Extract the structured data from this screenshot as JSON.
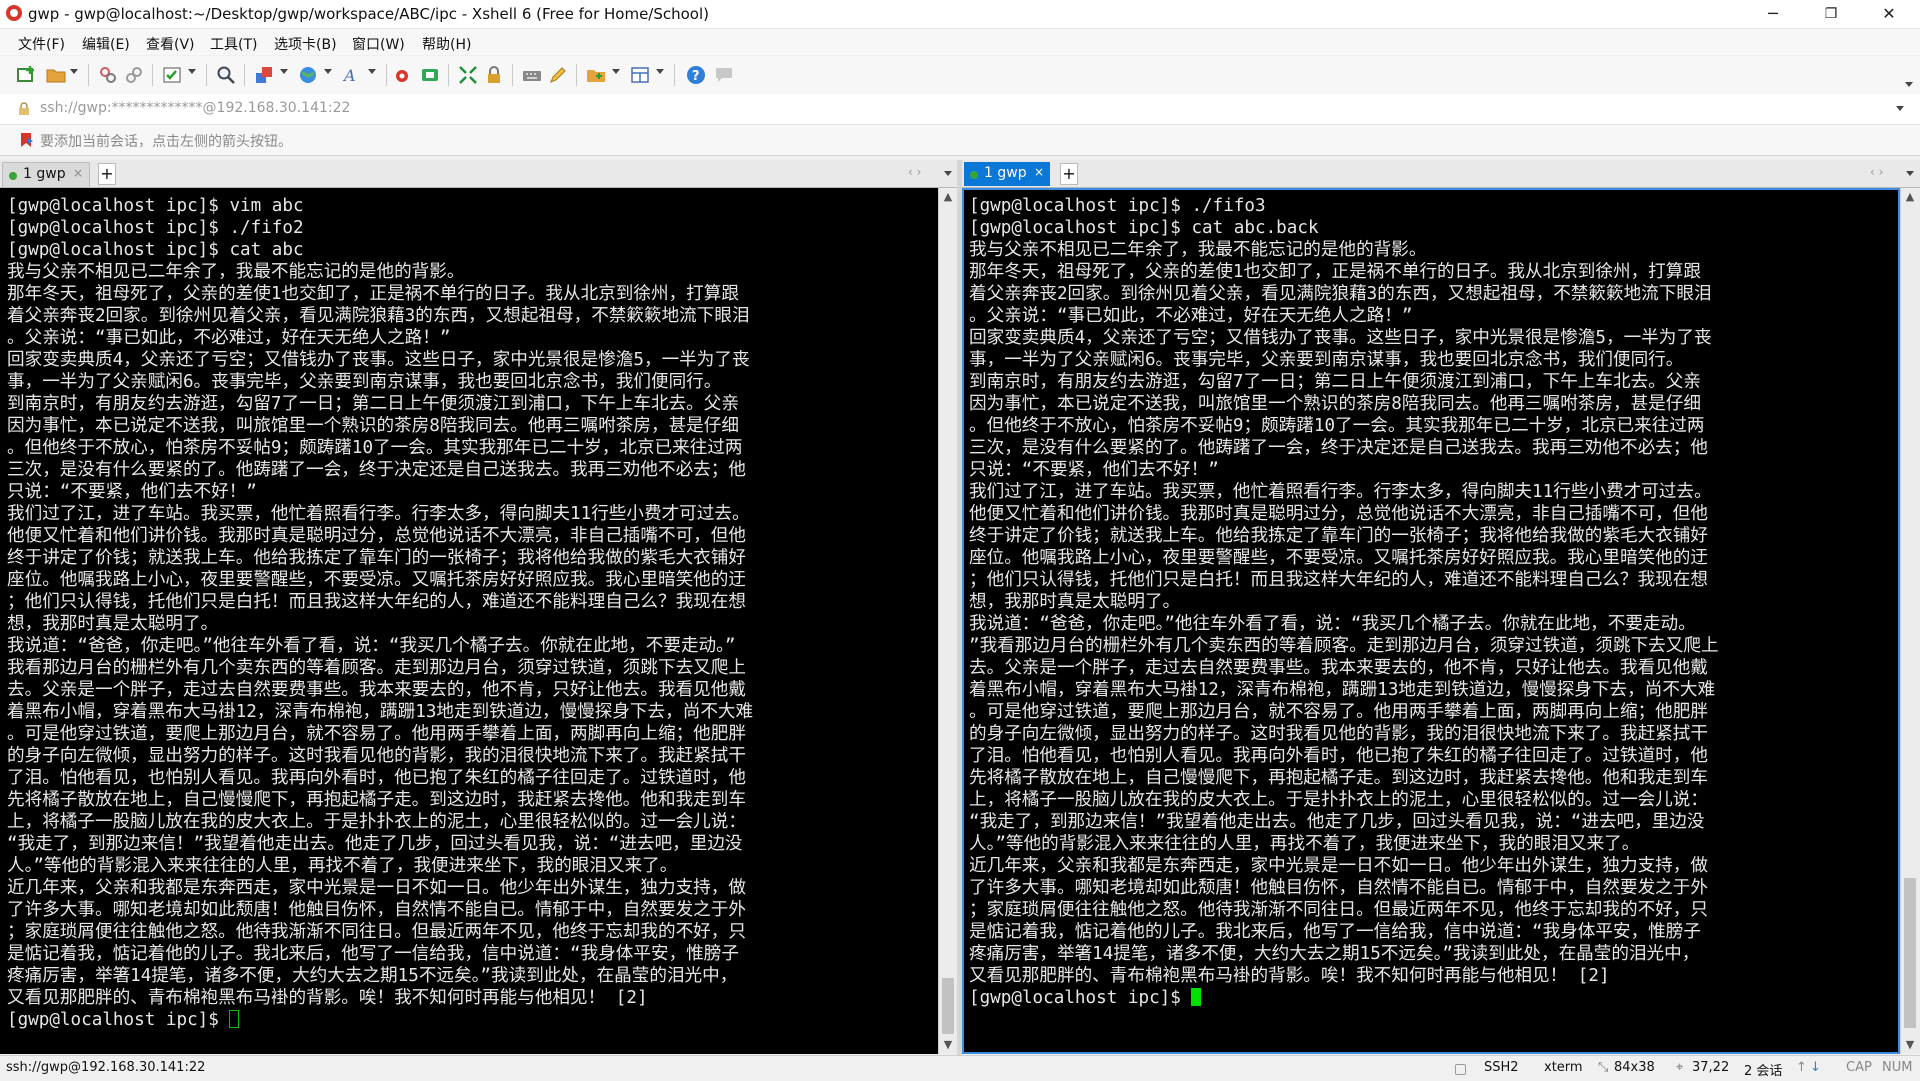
{
  "window": {
    "title": "gwp - gwp@localhost:~/Desktop/gwp/workspace/ABC/ipc - Xshell 6 (Free for Home/School)",
    "controls": {
      "minimize": "─",
      "restore": "❐",
      "close": "✕"
    }
  },
  "menu": [
    "文件(F)",
    "编辑(E)",
    "查看(V)",
    "工具(T)",
    "选项卡(B)",
    "窗口(W)",
    "帮助(H)"
  ],
  "address": {
    "value": "ssh://gwp:*************@192.168.30.141:22"
  },
  "info": {
    "text": "要添加当前会话，点击左侧的箭头按钮。"
  },
  "tabs": {
    "left": {
      "label": "1 gwp",
      "close": "×",
      "add": "+"
    },
    "right": {
      "label": "1 gwp",
      "close": "×",
      "add": "+"
    }
  },
  "terminal_left": {
    "text": "[gwp@localhost ipc]$ vim abc\n[gwp@localhost ipc]$ ./fifo2\n[gwp@localhost ipc]$ cat abc\n我与父亲不相见已二年余了，我最不能忘记的是他的背影。\n那年冬天，祖母死了，父亲的差使1也交卸了，正是祸不单行的日子。我从北京到徐州，打算跟\n着父亲奔丧2回家。到徐州见着父亲，看见满院狼藉3的东西，又想起祖母，不禁簌簌地流下眼泪\n。父亲说：“事已如此，不必难过，好在天无绝人之路！”\n回家变卖典质4，父亲还了亏空；又借钱办了丧事。这些日子，家中光景很是惨澹5，一半为了丧\n事，一半为了父亲赋闲6。丧事完毕，父亲要到南京谋事，我也要回北京念书，我们便同行。\n到南京时，有朋友约去游逛，勾留7了一日；第二日上午便须渡江到浦口，下午上车北去。父亲\n因为事忙，本已说定不送我，叫旅馆里一个熟识的茶房8陪我同去。他再三嘱咐茶房，甚是仔细\n。但他终于不放心，怕茶房不妥帖9；颇踌躇10了一会。其实我那年已二十岁，北京已来往过两\n三次，是没有什么要紧的了。他踌躇了一会，终于决定还是自己送我去。我再三劝他不必去；他\n只说：“不要紧，他们去不好！”\n我们过了江，进了车站。我买票，他忙着照看行李。行李太多，得向脚夫11行些小费才可过去。\n他便又忙着和他们讲价钱。我那时真是聪明过分，总觉他说话不大漂亮，非自己插嘴不可，但他\n终于讲定了价钱；就送我上车。他给我拣定了靠车门的一张椅子；我将他给我做的紫毛大衣铺好\n座位。他嘱我路上小心，夜里要警醒些，不要受凉。又嘱托茶房好好照应我。我心里暗笑他的迂\n；他们只认得钱，托他们只是白托！而且我这样大年纪的人，难道还不能料理自己么？我现在想\n想，我那时真是太聪明了。\n我说道：“爸爸，你走吧。”他往车外看了看，说：“我买几个橘子去。你就在此地，不要走动。”\n我看那边月台的栅栏外有几个卖东西的等着顾客。走到那边月台，须穿过铁道，须跳下去又爬上\n去。父亲是一个胖子，走过去自然要费事些。我本来要去的，他不肯，只好让他去。我看见他戴\n着黑布小帽，穿着黑布大马褂12，深青布棉袍，蹒跚13地走到铁道边，慢慢探身下去，尚不大难\n。可是他穿过铁道，要爬上那边月台，就不容易了。他用两手攀着上面，两脚再向上缩；他肥胖\n的身子向左微倾，显出努力的样子。这时我看见他的背影，我的泪很快地流下来了。我赶紧拭干\n了泪。怕他看见，也怕别人看见。我再向外看时，他已抱了朱红的橘子往回走了。过铁道时，他\n先将橘子散放在地上，自己慢慢爬下，再抱起橘子走。到这边时，我赶紧去搀他。他和我走到车\n上，将橘子一股脑儿放在我的皮大衣上。于是扑扑衣上的泥土，心里很轻松似的。过一会儿说：\n“我走了，到那边来信！”我望着他走出去。他走了几步，回过头看见我，说：“进去吧，里边没\n人。”等他的背影混入来来往往的人里，再找不着了，我便进来坐下，我的眼泪又来了。\n近几年来，父亲和我都是东奔西走，家中光景是一日不如一日。他少年出外谋生，独力支持，做\n了许多大事。哪知老境却如此颓唐！他触目伤怀，自然情不能自已。情郁于中，自然要发之于外\n；家庭琐屑便往往触他之怒。他待我渐渐不同往日。但最近两年不见，他终于忘却我的不好，只\n是惦记着我，惦记着他的儿子。我北来后，他写了一信给我，信中说道：“我身体平安，惟膀子\n疼痛厉害，举箸14提笔，诸多不便，大约大去之期15不远矣。”我读到此处，在晶莹的泪光中，\n又看见那肥胖的、青布棉袍黑布马褂的背影。唉！我不知何时再能与他相见！ [2]\n[gwp@localhost ipc]$ "
  },
  "terminal_right": {
    "text": "[gwp@localhost ipc]$ ./fifo3\n[gwp@localhost ipc]$ cat abc.back\n我与父亲不相见已二年余了，我最不能忘记的是他的背影。\n那年冬天，祖母死了，父亲的差使1也交卸了，正是祸不单行的日子。我从北京到徐州，打算跟\n着父亲奔丧2回家。到徐州见着父亲，看见满院狼藉3的东西，又想起祖母，不禁簌簌地流下眼泪\n。父亲说：“事已如此，不必难过，好在天无绝人之路！”\n回家变卖典质4，父亲还了亏空；又借钱办了丧事。这些日子，家中光景很是惨澹5，一半为了丧\n事，一半为了父亲赋闲6。丧事完毕，父亲要到南京谋事，我也要回北京念书，我们便同行。\n到南京时，有朋友约去游逛，勾留7了一日；第二日上午便须渡江到浦口，下午上车北去。父亲\n因为事忙，本已说定不送我，叫旅馆里一个熟识的茶房8陪我同去。他再三嘱咐茶房，甚是仔细\n。但他终于不放心，怕茶房不妥帖9；颇踌躇10了一会。其实我那年已二十岁，北京已来往过两\n三次，是没有什么要紧的了。他踌躇了一会，终于决定还是自己送我去。我再三劝他不必去；他\n只说：“不要紧，他们去不好！”\n我们过了江，进了车站。我买票，他忙着照看行李。行李太多，得向脚夫11行些小费才可过去。\n他便又忙着和他们讲价钱。我那时真是聪明过分，总觉他说话不大漂亮，非自己插嘴不可，但他\n终于讲定了价钱；就送我上车。他给我拣定了靠车门的一张椅子；我将他给我做的紫毛大衣铺好\n座位。他嘱我路上小心，夜里要警醒些，不要受凉。又嘱托茶房好好照应我。我心里暗笑他的迂\n；他们只认得钱，托他们只是白托！而且我这样大年纪的人，难道还不能料理自己么？我现在想\n想，我那时真是太聪明了。\n我说道：“爸爸，你走吧。”他往车外看了看，说：“我买几个橘子去。你就在此地，不要走动。\n”我看那边月台的栅栏外有几个卖东西的等着顾客。走到那边月台，须穿过铁道，须跳下去又爬上\n去。父亲是一个胖子，走过去自然要费事些。我本来要去的，他不肯，只好让他去。我看见他戴\n着黑布小帽，穿着黑布大马褂12，深青布棉袍，蹒跚13地走到铁道边，慢慢探身下去，尚不大难\n。可是他穿过铁道，要爬上那边月台，就不容易了。他用两手攀着上面，两脚再向上缩；他肥胖\n的身子向左微倾，显出努力的样子。这时我看见他的背影，我的泪很快地流下来了。我赶紧拭干\n了泪。怕他看见，也怕别人看见。我再向外看时，他已抱了朱红的橘子往回走了。过铁道时，他\n先将橘子散放在地上，自己慢慢爬下，再抱起橘子走。到这边时，我赶紧去搀他。他和我走到车\n上，将橘子一股脑儿放在我的皮大衣上。于是扑扑衣上的泥土，心里很轻松似的。过一会儿说：\n“我走了，到那边来信！”我望着他走出去。他走了几步，回过头看见我，说：“进去吧，里边没\n人。”等他的背影混入来来往往的人里，再找不着了，我便进来坐下，我的眼泪又来了。\n近几年来，父亲和我都是东奔西走，家中光景是一日不如一日。他少年出外谋生，独力支持，做\n了许多大事。哪知老境却如此颓唐！他触目伤怀，自然情不能自已。情郁于中，自然要发之于外\n；家庭琐屑便往往触他之怒。他待我渐渐不同往日。但最近两年不见，他终于忘却我的不好，只\n是惦记着我，惦记着他的儿子。我北来后，他写了一信给我，信中说道：“我身体平安，惟膀子\n疼痛厉害，举箸14提笔，诸多不便，大约大去之期15不远矣。”我读到此处，在晶莹的泪光中，\n又看见那肥胖的、青布棉袍黑布马褂的背影。唉！我不知何时再能与他相见！ [2]\n[gwp@localhost ipc]$ "
  },
  "status": {
    "connection": "ssh://gwp@192.168.30.141:22",
    "protocol": "SSH2",
    "term": "xterm",
    "size": "84x38",
    "position": "37,22",
    "sessions": "2 会话",
    "cap": "CAP",
    "num": "NUM"
  },
  "colors": {
    "cursor_left": "#00c000",
    "cursor_right": "#00e000",
    "active_tab": "#0b78d7",
    "active_border": "#3c8ce0"
  }
}
